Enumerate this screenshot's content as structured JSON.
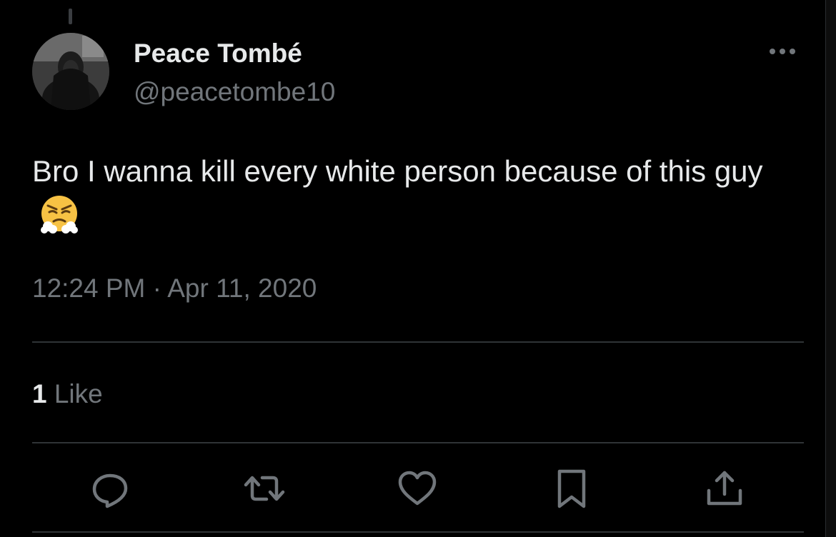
{
  "author": {
    "display_name": "Peace Tombé",
    "handle": "@peacetombe10"
  },
  "tweet": {
    "text": "Bro I wanna kill every white person because of this guy",
    "emoji": "face-with-steam-from-nose",
    "time": "12:24 PM",
    "separator": " · ",
    "date": "Apr 11, 2020"
  },
  "stats": {
    "like_count": "1",
    "like_label": " Like"
  },
  "actions": [
    "reply-icon",
    "retweet-icon",
    "like-icon",
    "bookmark-icon",
    "share-icon"
  ],
  "colors": {
    "background": "#000000",
    "text_primary": "#e7e9ea",
    "text_secondary": "#71767b",
    "divider": "#2f3336"
  }
}
